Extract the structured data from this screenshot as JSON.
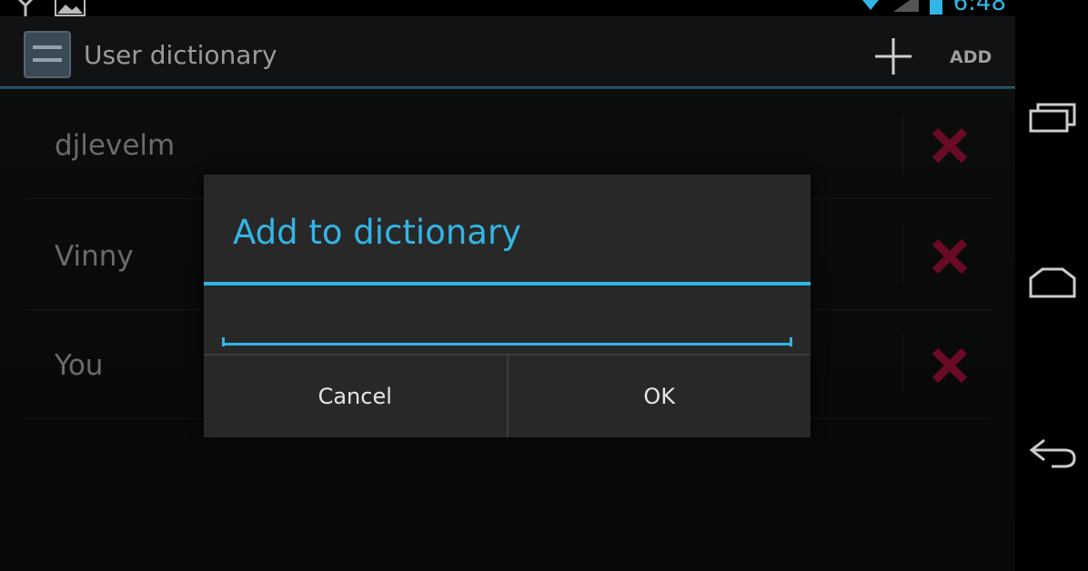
{
  "status_bar": {
    "clock": "6:48",
    "icons": [
      "antenna-icon",
      "image-notification-icon",
      "wifi-icon",
      "signal-icon",
      "battery-icon"
    ]
  },
  "action_bar": {
    "title": "User dictionary",
    "add_label": "ADD",
    "icons": [
      "user-dictionary-app-icon",
      "add-plus-icon"
    ]
  },
  "words": [
    {
      "text": "djlevelm"
    },
    {
      "text": "Vinny"
    },
    {
      "text": "You"
    }
  ],
  "dialog": {
    "title": "Add to dictionary",
    "input_value": "",
    "cancel_label": "Cancel",
    "ok_label": "OK"
  },
  "nav_bar": {
    "icons": [
      "recent-apps-icon",
      "home-icon",
      "back-icon"
    ]
  },
  "colors": {
    "accent": "#33b5e5",
    "delete": "#a3113a",
    "background": "#0e0f10",
    "dialog": "#282828"
  }
}
